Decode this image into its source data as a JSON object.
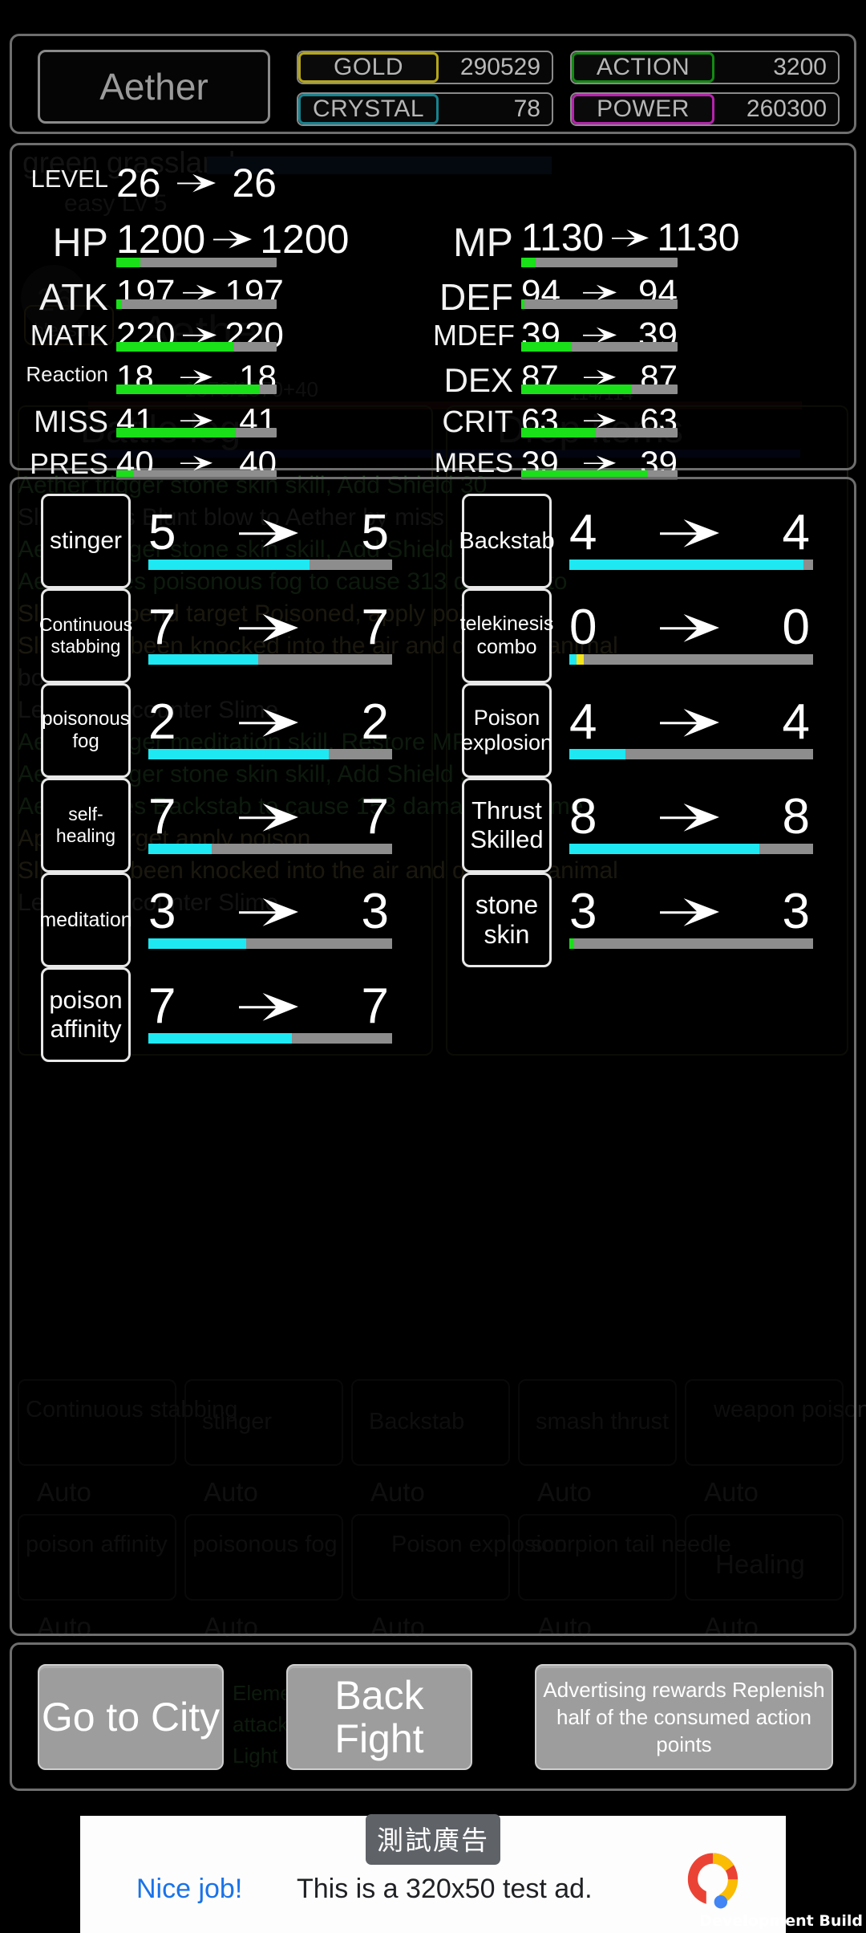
{
  "header": {
    "player_name": "Aether",
    "resources": [
      {
        "label": "GOLD",
        "value": "290529",
        "color": "#b5a619"
      },
      {
        "label": "ACTION",
        "value": "3200",
        "color": "#128a12"
      },
      {
        "label": "CRYSTAL",
        "value": "78",
        "color": "#17838f"
      },
      {
        "label": "POWER",
        "value": "260300",
        "color": "#b423ab"
      }
    ]
  },
  "stats": {
    "left": [
      {
        "name": "LEVEL",
        "from": "26",
        "to": "26",
        "bar": null,
        "label_size": 31,
        "value_size": 50
      },
      {
        "name": "HP",
        "from": "1200",
        "to": "1200",
        "bar": 15,
        "label_size": 50,
        "value_size": 50
      },
      {
        "name": "ATK",
        "from": "197",
        "to": "197",
        "bar": 3,
        "label_size": 46,
        "value_size": 44
      },
      {
        "name": "MATK",
        "from": "220",
        "to": "220",
        "bar": 73,
        "label_size": 36,
        "value_size": 44
      },
      {
        "name": "Reaction",
        "from": "18",
        "to": "18",
        "bar": 89,
        "label_size": 26,
        "value_size": 42
      },
      {
        "name": "MISS",
        "from": "41",
        "to": "41",
        "bar": 74,
        "label_size": 38,
        "value_size": 42
      },
      {
        "name": "PRES",
        "from": "40",
        "to": "40",
        "bar": 11,
        "label_size": 36,
        "value_size": 42
      }
    ],
    "right": [
      {
        "name": "MP",
        "from": "1130",
        "to": "1130",
        "bar": 9,
        "label_size": 50,
        "value_size": 48
      },
      {
        "name": "DEF",
        "from": "94",
        "to": "94",
        "bar": 2,
        "label_size": 46,
        "value_size": 44
      },
      {
        "name": "MDEF",
        "from": "39",
        "to": "39",
        "bar": 32,
        "label_size": 36,
        "value_size": 44
      },
      {
        "name": "DEX",
        "from": "87",
        "to": "87",
        "bar": 71,
        "label_size": 42,
        "value_size": 42
      },
      {
        "name": "CRIT",
        "from": "63",
        "to": "63",
        "bar": 47,
        "label_size": 38,
        "value_size": 42
      },
      {
        "name": "MRES",
        "from": "39",
        "to": "39",
        "bar": 81,
        "label_size": 34,
        "value_size": 42
      }
    ]
  },
  "skills": {
    "left": [
      {
        "name": "stinger",
        "from": "5",
        "to": "5",
        "bar_cyan": 66,
        "bar_yellow": 0,
        "name_size": 30,
        "value_size": 62
      },
      {
        "name": "Continuous stabbing",
        "from": "7",
        "to": "7",
        "bar_cyan": 45,
        "bar_yellow": 0,
        "name_size": 23,
        "value_size": 62
      },
      {
        "name": "poisonous fog",
        "from": "2",
        "to": "2",
        "bar_cyan": 74,
        "bar_yellow": 0,
        "name_size": 24,
        "value_size": 62
      },
      {
        "name": "self-healing",
        "from": "7",
        "to": "7",
        "bar_cyan": 26,
        "bar_yellow": 0,
        "name_size": 23,
        "value_size": 62
      },
      {
        "name": "meditation",
        "from": "3",
        "to": "3",
        "bar_cyan": 40,
        "bar_yellow": 0,
        "name_size": 25,
        "value_size": 62
      },
      {
        "name": "poison affinity",
        "from": "7",
        "to": "7",
        "bar_cyan": 59,
        "bar_yellow": 0,
        "name_size": 31,
        "value_size": 62
      }
    ],
    "right": [
      {
        "name": "Backstab",
        "from": "4",
        "to": "4",
        "bar_cyan": 96,
        "bar_yellow": 0,
        "name_size": 29,
        "value_size": 62
      },
      {
        "name": "telekinesis combo",
        "from": "0",
        "to": "0",
        "bar_cyan": 3,
        "bar_yellow": 3,
        "name_size": 25,
        "value_size": 62
      },
      {
        "name": "Poison explosion",
        "from": "4",
        "to": "4",
        "bar_cyan": 23,
        "bar_yellow": 0,
        "name_size": 27,
        "value_size": 62
      },
      {
        "name": "Thrust Skilled",
        "from": "8",
        "to": "8",
        "bar_cyan": 78,
        "bar_yellow": 0,
        "name_size": 31,
        "value_size": 62
      },
      {
        "name": "stone skin",
        "from": "3",
        "to": "3",
        "bar_cyan": 0,
        "bar_yellow": 0,
        "bar_green": 2,
        "name_size": 32,
        "value_size": 62
      },
      {
        "name": "",
        "from": "",
        "to": "",
        "bar_cyan": 0,
        "bar_yellow": 0,
        "name_size": 30,
        "value_size": 62,
        "empty": true
      }
    ]
  },
  "bottom_buttons": [
    {
      "label": "Go to City",
      "size": "big"
    },
    {
      "label": "Back Fight",
      "size": "big"
    },
    {
      "label": "Advertising rewards Replenish half of the consumed action points",
      "size": "small"
    }
  ],
  "ad": {
    "badge": "測試廣告",
    "cta": "Nice job!",
    "body": "This is a 320x50 test ad."
  },
  "watermark": "Development Build",
  "background_layer": {
    "zone_title": "green grassland",
    "zone_sub": "easy Lv 5",
    "player_name": "Aether",
    "player_level": "26",
    "hp_text": "1370/1370+40",
    "mp_text": "114/114",
    "blessing": "blessing",
    "battle_log_title": "Battle log",
    "drop_items_title": "Drop items",
    "log_lines": [
      "Aether trigger stone skin skill, Add Shield 30",
      "Slime uses Blunt blow to Aether by miss",
      "Aether trigger stone skin skill, Add Shield 30",
      "Aether uses poisonous fog to cause 313 damage to",
      "Slime , Append target Poisoned, apply poison",
      "Slime has been knocked into the air and dropped animal",
      "bones",
      "Level 4 Encounter Slime",
      "Aether trigger meditation skill, Restore MP 60",
      "Aether trigger stone skin skill, Add Shield 30",
      "Aether uses Backstab to cause 153 damage to Slime,",
      "Append target apply poison",
      "Slime has been knocked into the air and dropped animal",
      "Level 5 Encounter Slime"
    ],
    "skill_slots": [
      "Continuous stabbing",
      "stinger",
      "Backstab",
      "smash thrust",
      "weapon poison",
      "poison affinity",
      "poisonous fog",
      "Poison explosion",
      "scorpion tail needle",
      "Healing"
    ],
    "auto_labels": [
      "Auto",
      "Auto",
      "Auto",
      "Auto",
      "Auto",
      "Auto",
      "Auto",
      "Auto",
      "Auto",
      "Auto"
    ],
    "buttons": [
      "Elemental attack Light"
    ]
  }
}
